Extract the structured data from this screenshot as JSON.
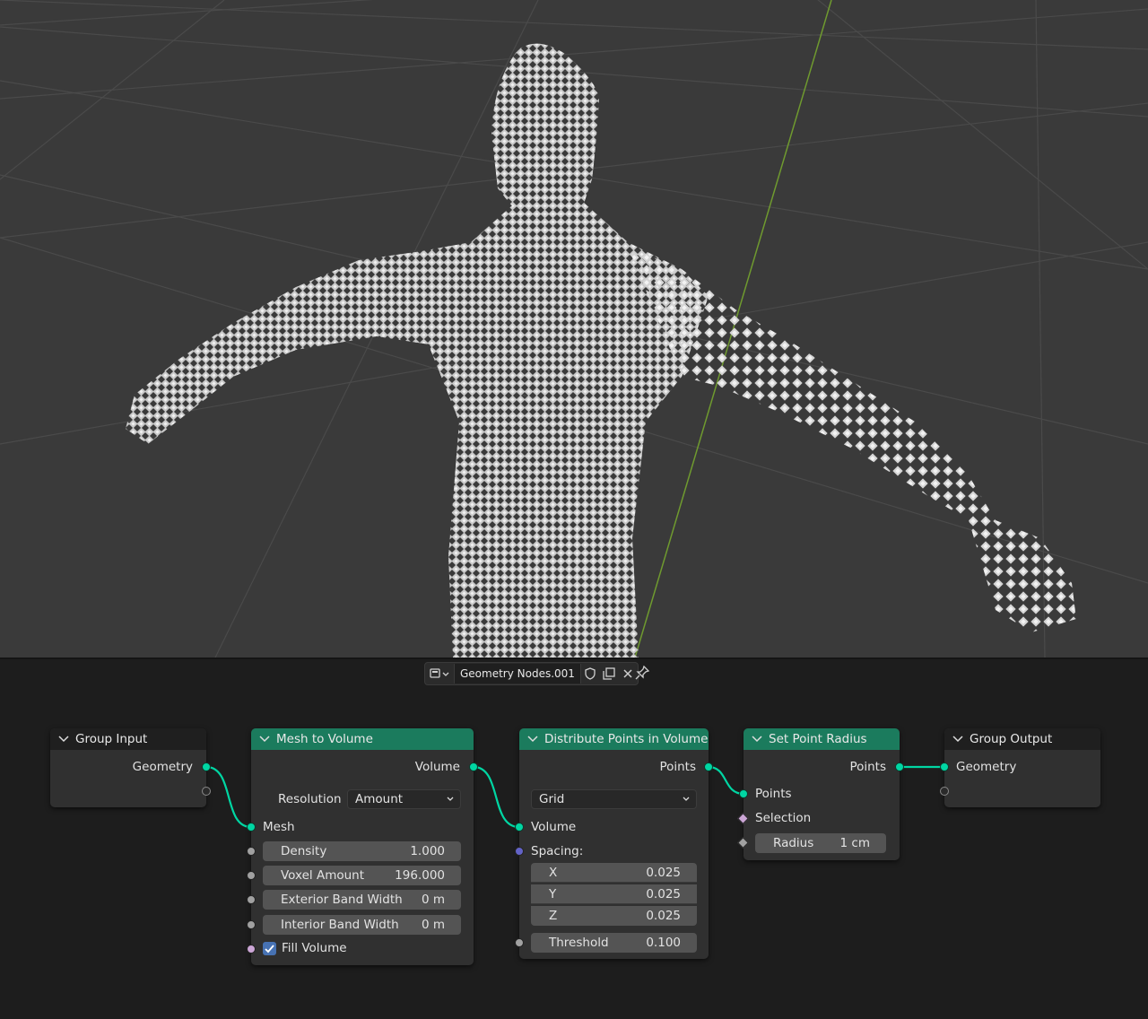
{
  "header": {
    "editor_type_icon": "node-tree-icon",
    "tree_name": "Geometry Nodes.001",
    "fake_user_icon": "shield-icon",
    "duplicate_icon": "duplicate-icon",
    "unlink_icon": "close-icon",
    "pin_icon": "pin-icon"
  },
  "colors": {
    "viewport_bg": "#3a3a3a",
    "editor_bg": "#1d1d1d",
    "node_bg": "#303030",
    "geometry_header": "#1b7b5d",
    "socket_geometry": "#00d6a3",
    "axis_y_line": "#6f9a2f"
  },
  "nodes": {
    "group_input": {
      "title": "Group Input",
      "outputs": [
        "Geometry"
      ]
    },
    "mesh_to_volume": {
      "title": "Mesh to Volume",
      "output": "Volume",
      "resolution_label": "Resolution",
      "resolution_value": "Amount",
      "input_mesh": "Mesh",
      "fields": [
        {
          "label": "Density",
          "value": "1.000"
        },
        {
          "label": "Voxel Amount",
          "value": "196.000"
        },
        {
          "label": "Exterior Band Width",
          "value": "0 m"
        },
        {
          "label": "Interior Band Width",
          "value": "0 m"
        }
      ],
      "fill_volume_label": "Fill Volume",
      "fill_volume_checked": true
    },
    "distribute": {
      "title": "Distribute Points in Volume",
      "output": "Points",
      "mode_value": "Grid",
      "input_volume": "Volume",
      "spacing_label": "Spacing:",
      "spacing": [
        {
          "label": "X",
          "value": "0.025"
        },
        {
          "label": "Y",
          "value": "0.025"
        },
        {
          "label": "Z",
          "value": "0.025"
        }
      ],
      "threshold_label": "Threshold",
      "threshold_value": "0.100"
    },
    "set_point_radius": {
      "title": "Set Point Radius",
      "output": "Points",
      "input_points": "Points",
      "selection_label": "Selection",
      "radius_label": "Radius",
      "radius_value": "1 cm"
    },
    "group_output": {
      "title": "Group Output",
      "input": "Geometry"
    }
  }
}
